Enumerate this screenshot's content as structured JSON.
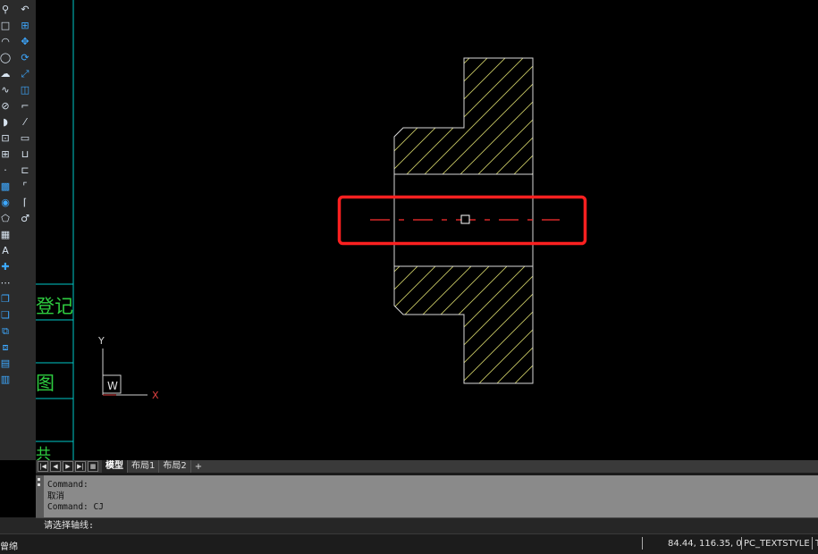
{
  "toolbar": {
    "col1": [
      {
        "icon": "align-icon",
        "glyph": "⚲"
      },
      {
        "icon": "rectangle-icon",
        "glyph": "□"
      },
      {
        "icon": "arc-icon",
        "glyph": "◠"
      },
      {
        "icon": "circle-icon",
        "glyph": "◯"
      },
      {
        "icon": "revcloud-icon",
        "glyph": "☁"
      },
      {
        "icon": "spline-icon",
        "glyph": "∿"
      },
      {
        "icon": "ellipse-icon",
        "glyph": "⊘"
      },
      {
        "icon": "ellipse-arc-icon",
        "glyph": "◗"
      },
      {
        "icon": "insert-block-icon",
        "glyph": "⊡"
      },
      {
        "icon": "make-block-icon",
        "glyph": "⊞"
      },
      {
        "icon": "point-icon",
        "glyph": "·"
      },
      {
        "icon": "hatch-icon",
        "glyph": "▩"
      },
      {
        "icon": "gradient-icon",
        "glyph": "◉"
      },
      {
        "icon": "region-icon",
        "glyph": "⬠"
      },
      {
        "icon": "table-icon",
        "glyph": "▦"
      },
      {
        "icon": "multiline-text-icon",
        "glyph": "A"
      },
      {
        "icon": "add-selected-icon",
        "glyph": "✚"
      },
      {
        "icon": "more-icon",
        "glyph": "⋯"
      },
      {
        "icon": "copy-icon",
        "glyph": "❐"
      },
      {
        "icon": "layer-icon",
        "glyph": "❏"
      },
      {
        "icon": "group-icon",
        "glyph": "⧉"
      },
      {
        "icon": "ungroup-icon",
        "glyph": "⧈"
      },
      {
        "icon": "properties-icon",
        "glyph": "▤"
      },
      {
        "icon": "match-properties-icon",
        "glyph": "▥"
      }
    ],
    "col2": [
      {
        "icon": "undo-icon",
        "glyph": "↶"
      },
      {
        "icon": "array-icon",
        "glyph": "⊞"
      },
      {
        "icon": "move-icon",
        "glyph": "✥"
      },
      {
        "icon": "rotate-icon",
        "glyph": "⟳"
      },
      {
        "icon": "scale-icon",
        "glyph": "⤢"
      },
      {
        "icon": "stretch-icon",
        "glyph": "◫"
      },
      {
        "icon": "trim-icon",
        "glyph": "⌐"
      },
      {
        "icon": "extend-icon",
        "glyph": "⁄"
      },
      {
        "icon": "break-icon",
        "glyph": "▭"
      },
      {
        "icon": "join-icon",
        "glyph": "⊔"
      },
      {
        "icon": "chamfer-icon",
        "glyph": "⊏"
      },
      {
        "icon": "fillet-icon",
        "glyph": "⌜"
      },
      {
        "icon": "blend-icon",
        "glyph": "⌈"
      },
      {
        "icon": "explode-icon",
        "glyph": "♂"
      }
    ]
  },
  "drawing": {
    "ucs_y_label": "Y",
    "ucs_x_label": "X",
    "ucs_w_label": "W",
    "side_text_1": "登记",
    "side_text_2": "图",
    "side_text_3": "共"
  },
  "tabs": {
    "nav": [
      "|◀",
      "◀",
      "▶",
      "▶|"
    ],
    "items": [
      {
        "label": "模型",
        "active": true
      },
      {
        "label": "布局1",
        "active": false
      },
      {
        "label": "布局2",
        "active": false
      }
    ],
    "add_label": "+"
  },
  "command": {
    "history": [
      "Command:",
      "取消",
      "Command: CJ"
    ],
    "prompt": "请选择轴线:"
  },
  "status": {
    "left_text": "曾绵",
    "coords": "84.44, 116.35, 0",
    "text_style": "PC_TEXTSTYLE",
    "tail": "T"
  },
  "colors": {
    "hatch": "#c8c864",
    "outline": "#d8d8d8",
    "centerline": "#ff3030",
    "highlight_box": "#ff2020",
    "frame": "#00c8c8",
    "frame_text": "#2ecc40"
  }
}
